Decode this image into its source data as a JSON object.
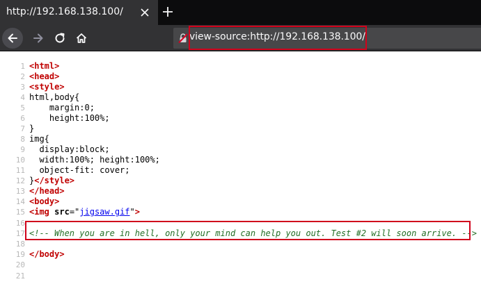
{
  "tab": {
    "title": "http://192.168.138.100/"
  },
  "urlbar": {
    "url": "view-source:http://192.168.138.100/"
  },
  "source": {
    "lines": [
      {
        "n": "1",
        "parts": [
          [
            "tag-red",
            "<html>"
          ]
        ]
      },
      {
        "n": "2",
        "parts": [
          [
            "tag-red",
            "<head>"
          ]
        ]
      },
      {
        "n": "3",
        "parts": [
          [
            "tag-red",
            "<style>"
          ]
        ]
      },
      {
        "n": "4",
        "parts": [
          [
            "plain",
            "html,body{"
          ]
        ]
      },
      {
        "n": "5",
        "parts": [
          [
            "plain",
            "    margin:0;"
          ]
        ]
      },
      {
        "n": "6",
        "parts": [
          [
            "plain",
            "    height:100%;"
          ]
        ]
      },
      {
        "n": "7",
        "parts": [
          [
            "plain",
            "}"
          ]
        ]
      },
      {
        "n": "8",
        "parts": [
          [
            "plain",
            "img{"
          ]
        ]
      },
      {
        "n": "9",
        "parts": [
          [
            "plain",
            "  display:block;"
          ]
        ]
      },
      {
        "n": "10",
        "parts": [
          [
            "plain",
            "  width:100%; height:100%;"
          ]
        ]
      },
      {
        "n": "11",
        "parts": [
          [
            "plain",
            "  object-fit: cover;"
          ]
        ]
      },
      {
        "n": "12",
        "parts": [
          [
            "plain",
            "}"
          ],
          [
            "tag-red",
            "</style>"
          ]
        ]
      },
      {
        "n": "13",
        "parts": [
          [
            "tag-red",
            "</head>"
          ]
        ]
      },
      {
        "n": "14",
        "parts": [
          [
            "tag-red",
            "<body>"
          ]
        ]
      },
      {
        "n": "15",
        "parts": [
          [
            "tag-red",
            "<img "
          ],
          [
            "attr",
            "src"
          ],
          [
            "plain",
            "=\""
          ],
          [
            "link",
            "jigsaw.gif"
          ],
          [
            "plain",
            "\""
          ],
          [
            "tag-red",
            ">"
          ]
        ]
      },
      {
        "n": "16",
        "parts": []
      },
      {
        "n": "17",
        "parts": [
          [
            "comment",
            "<!-- When you are in hell, only your mind can help you out. Test #2 will soon arrive. -->"
          ]
        ]
      },
      {
        "n": "18",
        "parts": []
      },
      {
        "n": "19",
        "parts": [
          [
            "tag-red",
            "</body>"
          ]
        ]
      },
      {
        "n": "20",
        "parts": []
      },
      {
        "n": "21",
        "parts": []
      }
    ]
  }
}
